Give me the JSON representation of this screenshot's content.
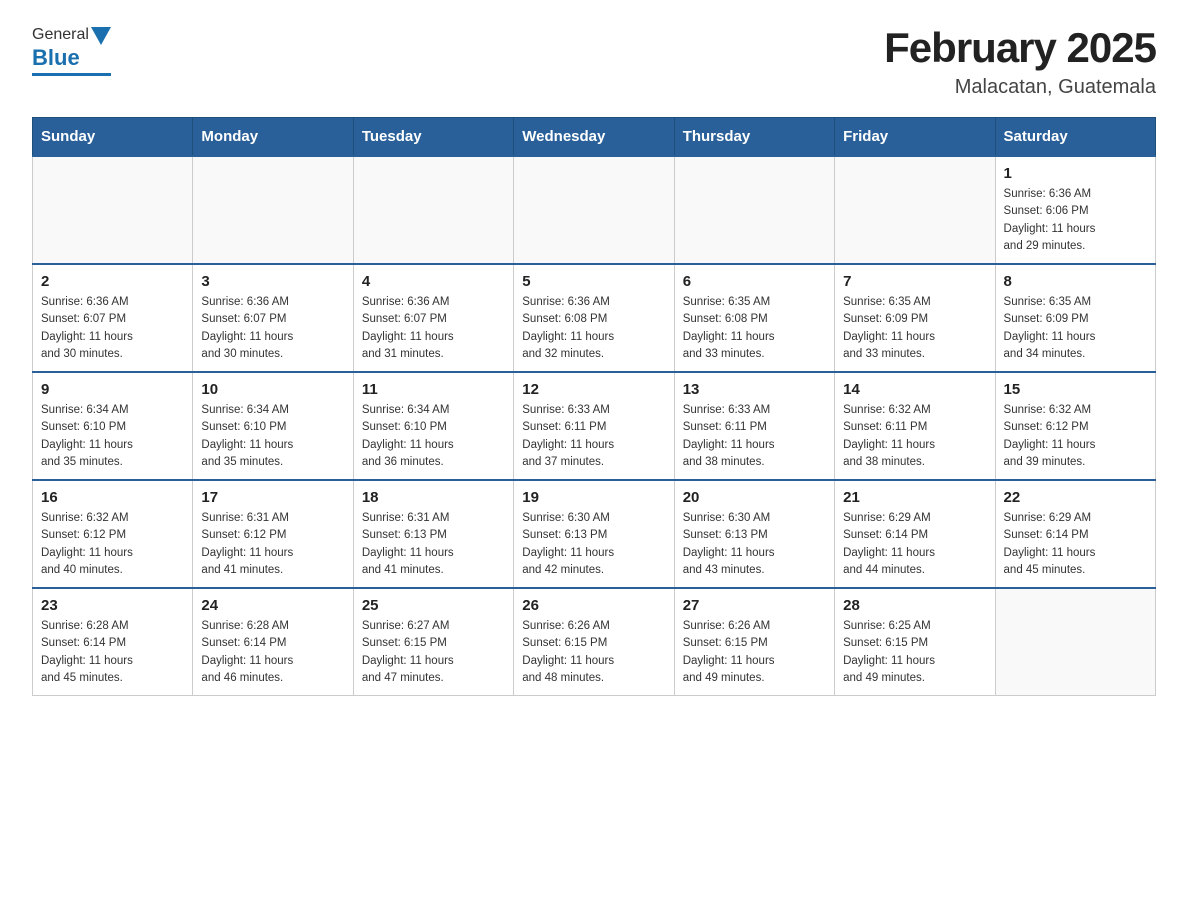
{
  "header": {
    "logo_general": "General",
    "logo_blue": "Blue",
    "main_title": "February 2025",
    "subtitle": "Malacatan, Guatemala"
  },
  "days_of_week": [
    "Sunday",
    "Monday",
    "Tuesday",
    "Wednesday",
    "Thursday",
    "Friday",
    "Saturday"
  ],
  "weeks": [
    {
      "days": [
        {
          "num": "",
          "info": ""
        },
        {
          "num": "",
          "info": ""
        },
        {
          "num": "",
          "info": ""
        },
        {
          "num": "",
          "info": ""
        },
        {
          "num": "",
          "info": ""
        },
        {
          "num": "",
          "info": ""
        },
        {
          "num": "1",
          "info": "Sunrise: 6:36 AM\nSunset: 6:06 PM\nDaylight: 11 hours\nand 29 minutes."
        }
      ]
    },
    {
      "days": [
        {
          "num": "2",
          "info": "Sunrise: 6:36 AM\nSunset: 6:07 PM\nDaylight: 11 hours\nand 30 minutes."
        },
        {
          "num": "3",
          "info": "Sunrise: 6:36 AM\nSunset: 6:07 PM\nDaylight: 11 hours\nand 30 minutes."
        },
        {
          "num": "4",
          "info": "Sunrise: 6:36 AM\nSunset: 6:07 PM\nDaylight: 11 hours\nand 31 minutes."
        },
        {
          "num": "5",
          "info": "Sunrise: 6:36 AM\nSunset: 6:08 PM\nDaylight: 11 hours\nand 32 minutes."
        },
        {
          "num": "6",
          "info": "Sunrise: 6:35 AM\nSunset: 6:08 PM\nDaylight: 11 hours\nand 33 minutes."
        },
        {
          "num": "7",
          "info": "Sunrise: 6:35 AM\nSunset: 6:09 PM\nDaylight: 11 hours\nand 33 minutes."
        },
        {
          "num": "8",
          "info": "Sunrise: 6:35 AM\nSunset: 6:09 PM\nDaylight: 11 hours\nand 34 minutes."
        }
      ]
    },
    {
      "days": [
        {
          "num": "9",
          "info": "Sunrise: 6:34 AM\nSunset: 6:10 PM\nDaylight: 11 hours\nand 35 minutes."
        },
        {
          "num": "10",
          "info": "Sunrise: 6:34 AM\nSunset: 6:10 PM\nDaylight: 11 hours\nand 35 minutes."
        },
        {
          "num": "11",
          "info": "Sunrise: 6:34 AM\nSunset: 6:10 PM\nDaylight: 11 hours\nand 36 minutes."
        },
        {
          "num": "12",
          "info": "Sunrise: 6:33 AM\nSunset: 6:11 PM\nDaylight: 11 hours\nand 37 minutes."
        },
        {
          "num": "13",
          "info": "Sunrise: 6:33 AM\nSunset: 6:11 PM\nDaylight: 11 hours\nand 38 minutes."
        },
        {
          "num": "14",
          "info": "Sunrise: 6:32 AM\nSunset: 6:11 PM\nDaylight: 11 hours\nand 38 minutes."
        },
        {
          "num": "15",
          "info": "Sunrise: 6:32 AM\nSunset: 6:12 PM\nDaylight: 11 hours\nand 39 minutes."
        }
      ]
    },
    {
      "days": [
        {
          "num": "16",
          "info": "Sunrise: 6:32 AM\nSunset: 6:12 PM\nDaylight: 11 hours\nand 40 minutes."
        },
        {
          "num": "17",
          "info": "Sunrise: 6:31 AM\nSunset: 6:12 PM\nDaylight: 11 hours\nand 41 minutes."
        },
        {
          "num": "18",
          "info": "Sunrise: 6:31 AM\nSunset: 6:13 PM\nDaylight: 11 hours\nand 41 minutes."
        },
        {
          "num": "19",
          "info": "Sunrise: 6:30 AM\nSunset: 6:13 PM\nDaylight: 11 hours\nand 42 minutes."
        },
        {
          "num": "20",
          "info": "Sunrise: 6:30 AM\nSunset: 6:13 PM\nDaylight: 11 hours\nand 43 minutes."
        },
        {
          "num": "21",
          "info": "Sunrise: 6:29 AM\nSunset: 6:14 PM\nDaylight: 11 hours\nand 44 minutes."
        },
        {
          "num": "22",
          "info": "Sunrise: 6:29 AM\nSunset: 6:14 PM\nDaylight: 11 hours\nand 45 minutes."
        }
      ]
    },
    {
      "days": [
        {
          "num": "23",
          "info": "Sunrise: 6:28 AM\nSunset: 6:14 PM\nDaylight: 11 hours\nand 45 minutes."
        },
        {
          "num": "24",
          "info": "Sunrise: 6:28 AM\nSunset: 6:14 PM\nDaylight: 11 hours\nand 46 minutes."
        },
        {
          "num": "25",
          "info": "Sunrise: 6:27 AM\nSunset: 6:15 PM\nDaylight: 11 hours\nand 47 minutes."
        },
        {
          "num": "26",
          "info": "Sunrise: 6:26 AM\nSunset: 6:15 PM\nDaylight: 11 hours\nand 48 minutes."
        },
        {
          "num": "27",
          "info": "Sunrise: 6:26 AM\nSunset: 6:15 PM\nDaylight: 11 hours\nand 49 minutes."
        },
        {
          "num": "28",
          "info": "Sunrise: 6:25 AM\nSunset: 6:15 PM\nDaylight: 11 hours\nand 49 minutes."
        },
        {
          "num": "",
          "info": ""
        }
      ]
    }
  ]
}
